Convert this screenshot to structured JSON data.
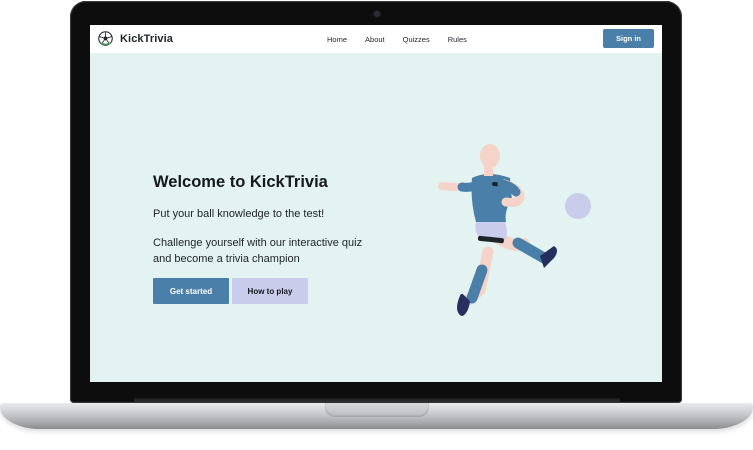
{
  "colors": {
    "accent": "#4a7fa9",
    "secondary": "#c9cceb",
    "hero_background": "#e2f3f1",
    "ball": "#c9cceb",
    "shirt": "#4a7fa9",
    "shorts": "#c9cceb",
    "skin": "#f6d3c8",
    "boots": "#25305f"
  },
  "header": {
    "logo_icon": "soccer-ball-icon",
    "brand": "KickTrivia",
    "nav": [
      "Home",
      "About",
      "Quizzes",
      "Rules"
    ],
    "signin_label": "Sign in"
  },
  "hero": {
    "title": "Welcome to KickTrivia",
    "subtitle": "Put your ball knowledge to the test!",
    "description": "Challenge yourself with our interactive quiz and become a trivia champion",
    "primary_label": "Get started",
    "secondary_label": "How to play",
    "illustration": "soccer-player-kicking-ball"
  }
}
